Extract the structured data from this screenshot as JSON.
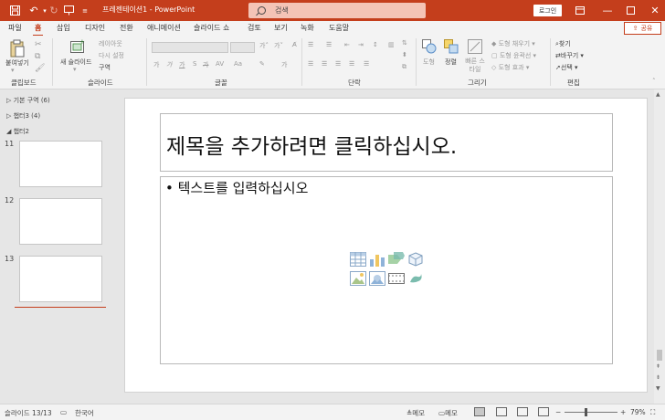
{
  "titlebar": {
    "doc_title": "프레젠테이션1 - PowerPoint",
    "search_placeholder": "검색",
    "login_label": "로그인",
    "colors": {
      "accent": "#c43e1c",
      "search_bg": "#f4c4b6"
    }
  },
  "tabs": {
    "items": [
      "파일",
      "홈",
      "삽입",
      "디자인",
      "전환",
      "애니메이션",
      "슬라이드 쇼",
      "검토",
      "보기",
      "녹화",
      "도움말"
    ],
    "active": "홈",
    "share_label": "공유"
  },
  "ribbon": {
    "clipboard": {
      "paste_label": "붙여넣기",
      "group_label": "클립보드"
    },
    "slides": {
      "new_slide_label": "새 슬라이드",
      "layout_label": "레이아웃",
      "reset_label": "다시 설정",
      "section_label": "구역",
      "group_label": "슬라이드"
    },
    "font": {
      "group_label": "글꼴"
    },
    "paragraph": {
      "group_label": "단락"
    },
    "drawing": {
      "shapes_label": "도형",
      "arrange_label": "정렬",
      "quick_styles_label": "빠른 스타일",
      "fill_label": "도형 채우기",
      "outline_label": "도형 윤곽선",
      "effects_label": "도형 효과",
      "group_label": "그리기"
    },
    "editing": {
      "find_label": "찾기",
      "replace_label": "바꾸기",
      "select_label": "선택",
      "group_label": "편집"
    }
  },
  "left_panel": {
    "sections": [
      {
        "label": "기본 구역 (6)"
      },
      {
        "label": "챕터3 (4)"
      },
      {
        "label": "챕터2"
      }
    ],
    "slides": [
      {
        "number": "11"
      },
      {
        "number": "12"
      },
      {
        "number": "13"
      }
    ]
  },
  "slide": {
    "title_placeholder": "제목을 추가하려면 클릭하십시오.",
    "body_placeholder": "텍스트를 입력하십시오"
  },
  "statusbar": {
    "slide_counter": "슬라이드 13/13",
    "language": "한국어",
    "notes_label": "슬라이드 노트",
    "notes_short": "메모",
    "comments_label": "메모",
    "zoom": "79%"
  }
}
